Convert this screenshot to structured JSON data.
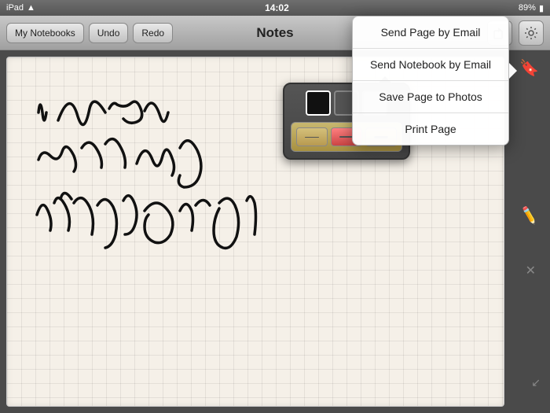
{
  "statusBar": {
    "left": "iPad",
    "time": "14:02",
    "battery": "89%",
    "wifi": "WiFi"
  },
  "toolbar": {
    "notebooksLabel": "My Notebooks",
    "undoLabel": "Undo",
    "redoLabel": "Redo",
    "title": "Notes"
  },
  "popoverMenu": {
    "items": [
      "Send Page by Email",
      "Send Notebook by Email",
      "Save Page to Photos",
      "Print Page"
    ]
  },
  "toolPalette": {
    "colors": [
      "black",
      "#555",
      "#999"
    ],
    "sizes": [
      "small",
      "medium",
      "large"
    ]
  },
  "handwriting": {
    "text": "I can use my finger or"
  }
}
